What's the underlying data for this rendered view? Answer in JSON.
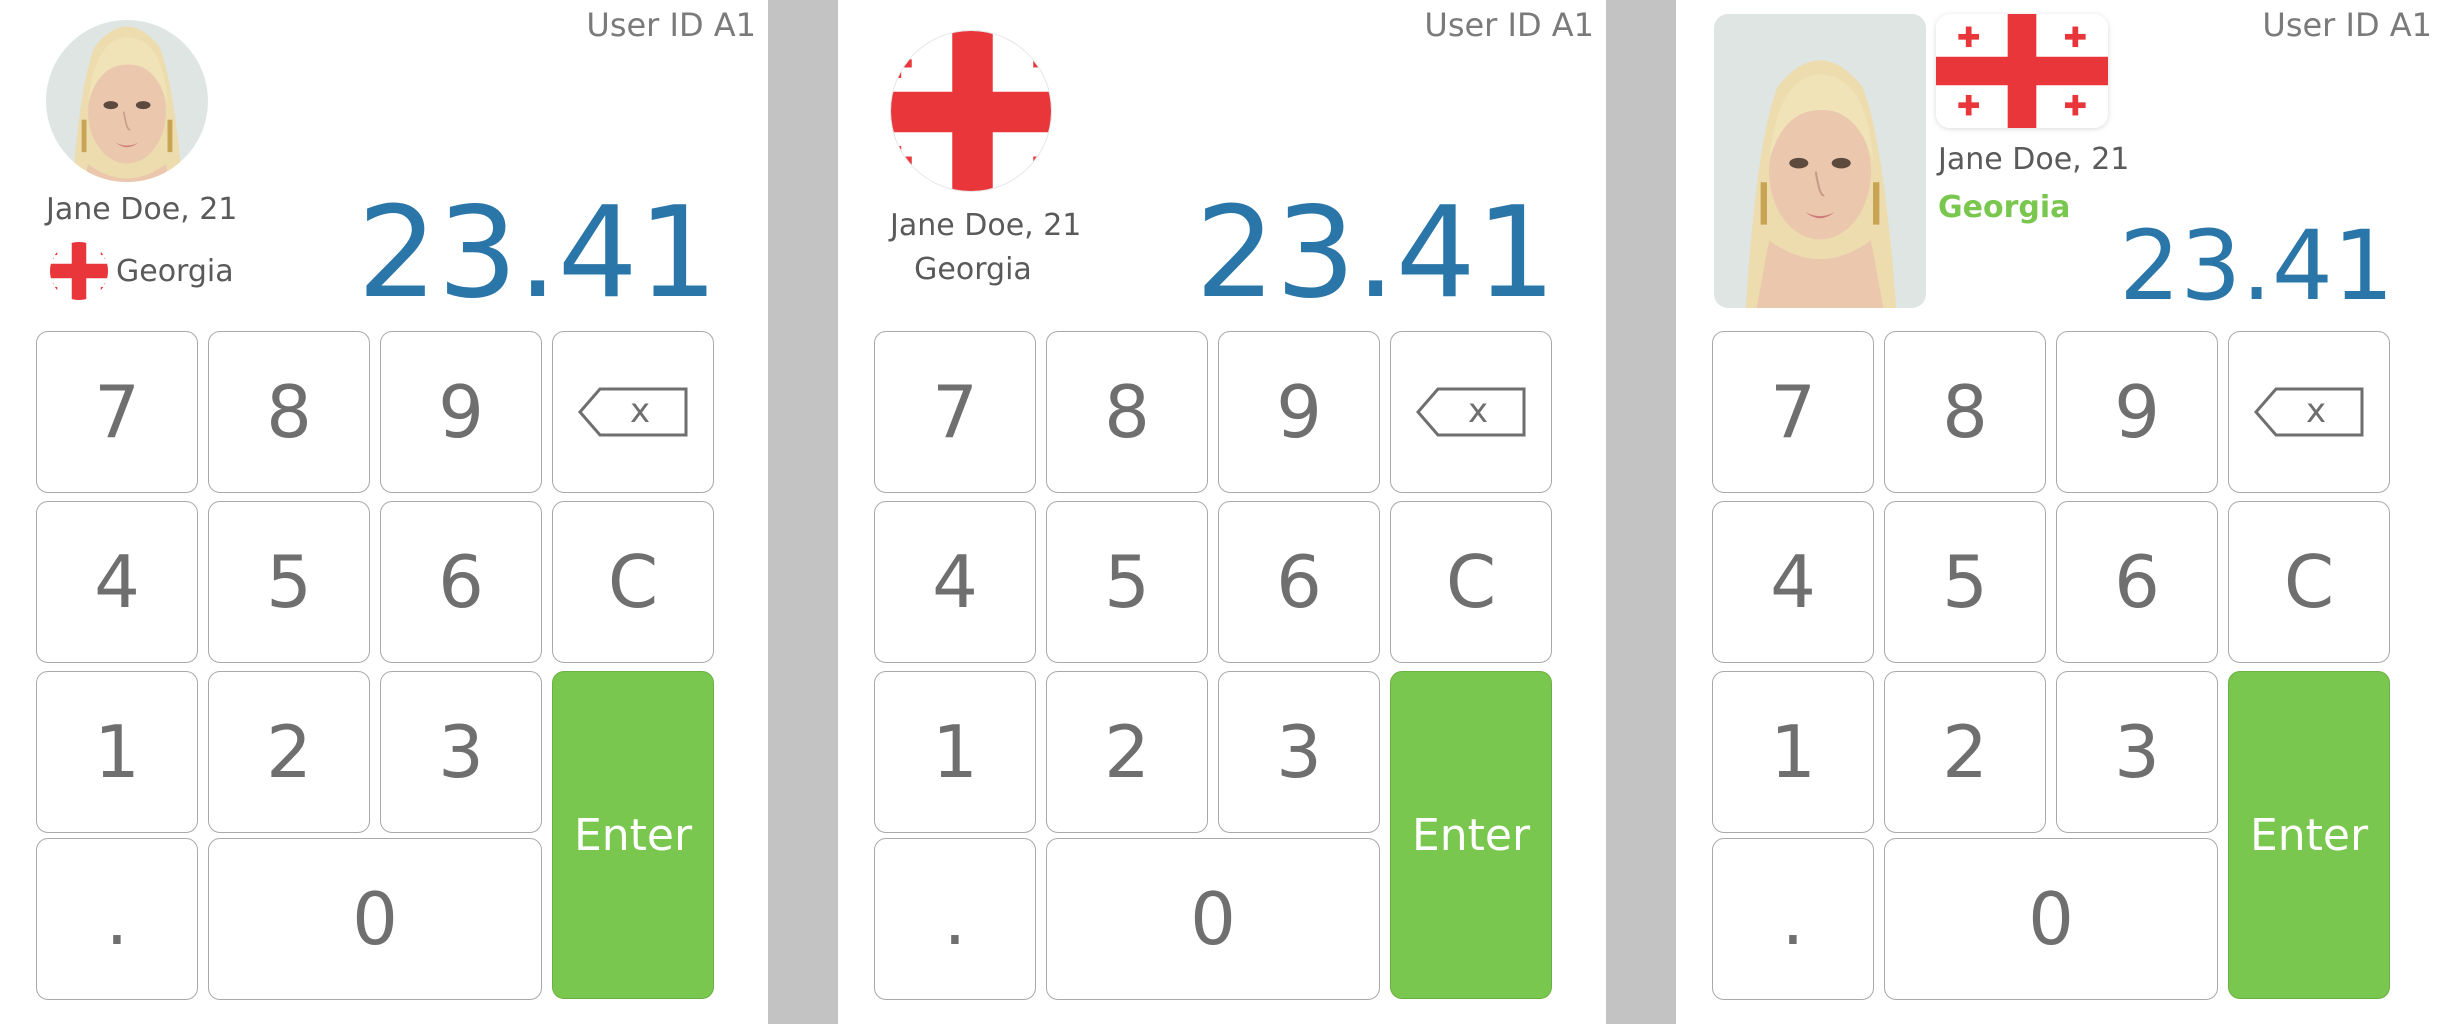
{
  "panels": [
    {
      "user_id": "User ID A1",
      "name": "Jane Doe, 21",
      "country": "Georgia",
      "amount": "23.41"
    },
    {
      "user_id": "User ID A1",
      "name": "Jane Doe, 21",
      "country": "Georgia",
      "amount": "23.41"
    },
    {
      "user_id": "User ID A1",
      "name": "Jane Doe, 21",
      "country": "Georgia",
      "amount": "23.41"
    }
  ],
  "keypad": {
    "k7": "7",
    "k8": "8",
    "k9": "9",
    "backspace": "x",
    "k4": "4",
    "k5": "5",
    "k6": "6",
    "clear": "C",
    "k1": "1",
    "k2": "2",
    "k3": "3",
    "enter": "Enter",
    "dot": ".",
    "k0": "0"
  },
  "icons": {
    "backspace": "backspace-icon",
    "flag": "georgia-flag-icon",
    "avatar": "user-avatar"
  },
  "colors": {
    "amount": "#2a76a8",
    "enter": "#7ac74f",
    "country_highlight": "#7ac74f",
    "flag_red": "#e8363a",
    "divider": "#c3c3c3"
  }
}
